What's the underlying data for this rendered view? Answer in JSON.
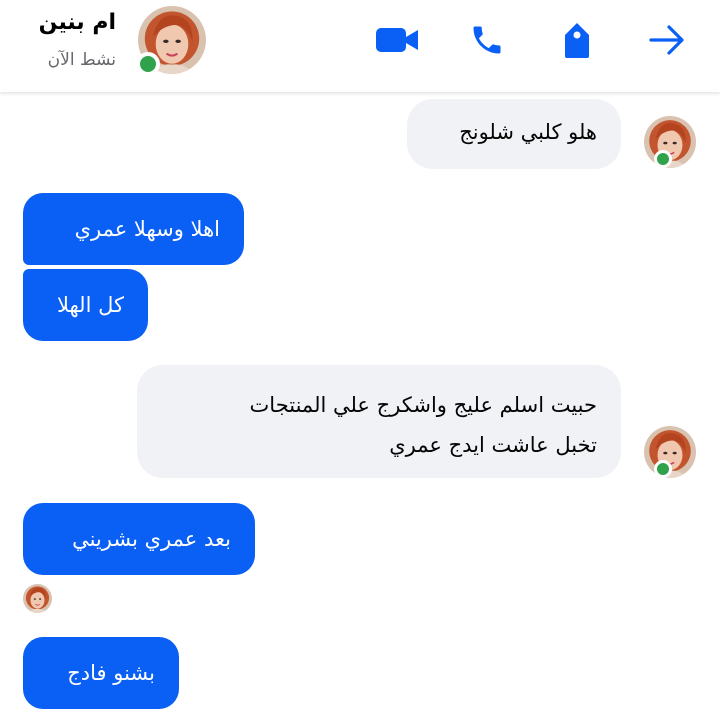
{
  "header": {
    "name": "ام بنين",
    "status": "نشط الآن",
    "icons": {
      "video": "video-camera-icon",
      "phone": "phone-icon",
      "tag": "tag-icon",
      "back": "arrow-right-icon"
    },
    "accent_color": "#0a5ff5",
    "online_color": "#31a24c"
  },
  "messages": [
    {
      "from": "contact",
      "text": "هلو كلبي شلونج"
    },
    {
      "from": "me",
      "text": "اهلا وسهلا عمري"
    },
    {
      "from": "me",
      "text": "كل الهلا"
    },
    {
      "from": "contact",
      "lines": [
        "حبيت  اسلم عليج واشكرج علي المنتجات",
        "تخبل عاشت  ايدج عمري"
      ]
    },
    {
      "from": "me",
      "text": "بعد عمري بشريني"
    },
    {
      "from": "me",
      "text": "بشنو فادج"
    }
  ],
  "colors": {
    "outgoing_bubble": "#0a5ff5",
    "incoming_bubble": "#f1f2f5",
    "secondary_text": "#65676b"
  }
}
